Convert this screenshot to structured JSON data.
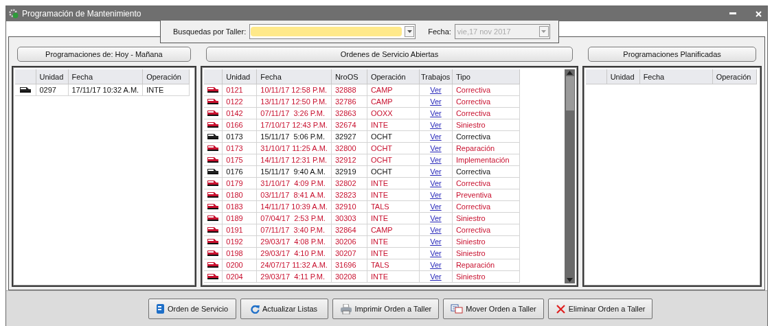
{
  "window": {
    "title": "Programación de Mantenimiento"
  },
  "filters": {
    "workshop": {
      "label": "Busquedas por Taller:"
    },
    "date": {
      "label": "Fecha:",
      "value": "vie,17 nov 2017",
      "disabled": true
    }
  },
  "panels": [
    {
      "title": "Programaciones de: Hoy - Mañana",
      "columns": [
        {
          "label": "Unidad",
          "kind": "text"
        },
        {
          "label": "Fecha",
          "kind": "text"
        },
        {
          "label": "Operación",
          "kind": "text"
        }
      ],
      "rows": [
        {
          "cells": [
            "0297",
            "17/11/17 10:32 A.M.",
            "INTE"
          ],
          "alert": false
        }
      ]
    },
    {
      "title": "Ordenes de Servicio Abiertas",
      "columns": [
        {
          "label": "Unidad",
          "kind": "text"
        },
        {
          "label": "Fecha",
          "kind": "text"
        },
        {
          "label": "NroOS",
          "kind": "text"
        },
        {
          "label": "Operación",
          "kind": "text"
        },
        {
          "label": "Trabajos",
          "kind": "link"
        },
        {
          "label": "Tipo",
          "kind": "text"
        }
      ],
      "rows": [
        {
          "cells": [
            "0121",
            "10/11/17 12:58 P.M.",
            "32888",
            "CAMP",
            "Ver",
            "Correctiva"
          ],
          "alert": true
        },
        {
          "cells": [
            "0122",
            "13/11/17 12:50 P.M.",
            "32786",
            "CAMP",
            "Ver",
            "Correctiva"
          ],
          "alert": true
        },
        {
          "cells": [
            "0142",
            "07/11/17  3:26 P.M.",
            "32863",
            "OOXX",
            "Ver",
            "Correctiva"
          ],
          "alert": true
        },
        {
          "cells": [
            "0166",
            "17/10/17 12:43 P.M.",
            "32674",
            "INTE",
            "Ver",
            "Siniestro"
          ],
          "alert": true
        },
        {
          "cells": [
            "0173",
            "15/11/17  5:06 P.M.",
            "32927",
            "OCHT",
            "Ver",
            "Correctiva"
          ],
          "alert": false
        },
        {
          "cells": [
            "0173",
            "31/10/17 11:25 A.M.",
            "32800",
            "OCHT",
            "Ver",
            "Reparación"
          ],
          "alert": true
        },
        {
          "cells": [
            "0175",
            "14/11/17 12:31 P.M.",
            "32912",
            "OCHT",
            "Ver",
            "Implementación"
          ],
          "alert": true
        },
        {
          "cells": [
            "0176",
            "15/11/17  9:40 A.M.",
            "32919",
            "OCHT",
            "Ver",
            "Correctiva"
          ],
          "alert": false
        },
        {
          "cells": [
            "0179",
            "31/10/17  4:09 P.M.",
            "32802",
            "INTE",
            "Ver",
            "Correctiva"
          ],
          "alert": true
        },
        {
          "cells": [
            "0180",
            "03/11/17  8:41 A.M.",
            "32823",
            "INTE",
            "Ver",
            "Preventiva"
          ],
          "alert": true
        },
        {
          "cells": [
            "0183",
            "14/11/17 10:39 A.M.",
            "32910",
            "TALS",
            "Ver",
            "Correctiva"
          ],
          "alert": true
        },
        {
          "cells": [
            "0189",
            "07/04/17  2:53 P.M.",
            "30303",
            "INTE",
            "Ver",
            "Siniestro"
          ],
          "alert": true
        },
        {
          "cells": [
            "0191",
            "07/11/17  3:40 P.M.",
            "32864",
            "CAMP",
            "Ver",
            "Correctiva"
          ],
          "alert": true
        },
        {
          "cells": [
            "0192",
            "29/03/17  4:08 P.M.",
            "30206",
            "INTE",
            "Ver",
            "Siniestro"
          ],
          "alert": true
        },
        {
          "cells": [
            "0198",
            "29/03/17  4:10 P.M.",
            "30207",
            "INTE",
            "Ver",
            "Siniestro"
          ],
          "alert": true
        },
        {
          "cells": [
            "0200",
            "24/07/17 11:32 A.M.",
            "31696",
            "TALS",
            "Ver",
            "Reparación"
          ],
          "alert": true
        },
        {
          "cells": [
            "0204",
            "29/03/17  4:11 P.M.",
            "30208",
            "INTE",
            "Ver",
            "Siniestro"
          ],
          "alert": true
        }
      ]
    },
    {
      "title": "Programaciones Planificadas",
      "columns": [
        {
          "label": "Unidad",
          "kind": "text"
        },
        {
          "label": "Fecha",
          "kind": "text"
        },
        {
          "label": "Operación",
          "kind": "text"
        }
      ]
    }
  ],
  "buttons": [
    {
      "label": "Orden de Servicio",
      "kind": "document"
    },
    {
      "label": "Actualizar Listas",
      "kind": "refresh"
    },
    {
      "label": "Imprimir Orden a Taller",
      "kind": "print"
    },
    {
      "label": "Mover Orden a Taller",
      "kind": "move"
    },
    {
      "label": "Eliminar Orden a Taller",
      "kind": "delete"
    }
  ]
}
